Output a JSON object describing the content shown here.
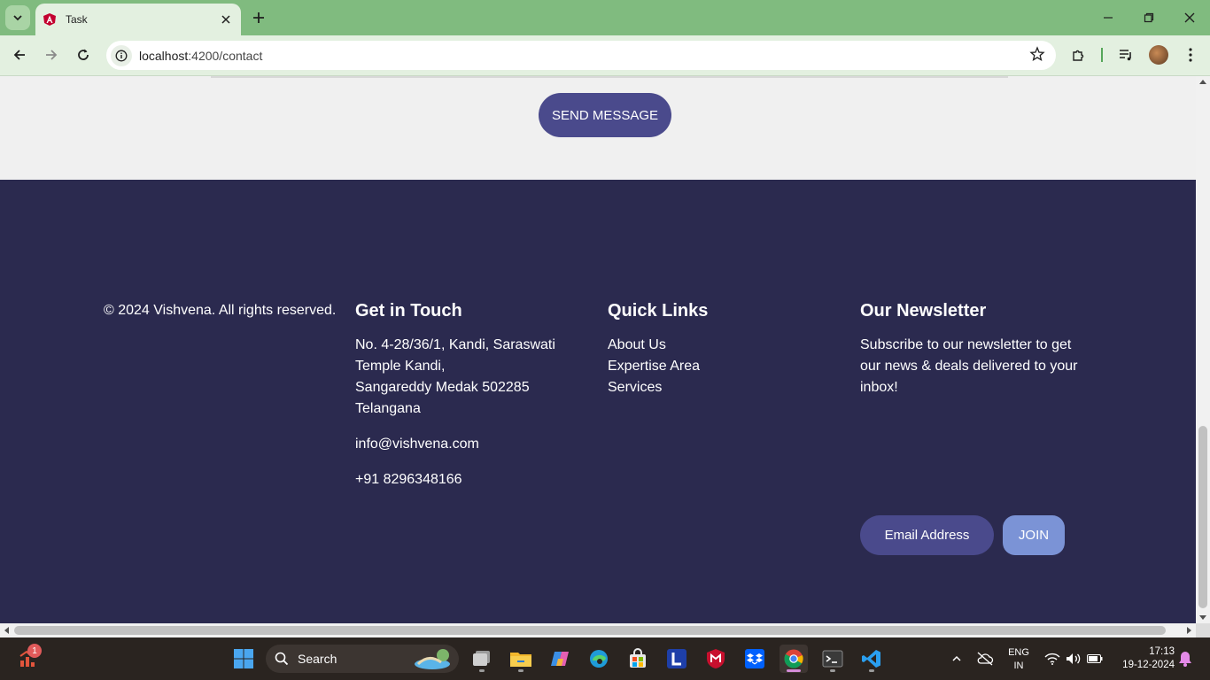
{
  "browser": {
    "tab_title": "Task",
    "url_host": "localhost",
    "url_path": ":4200/contact"
  },
  "page": {
    "send_button_label": "SEND MESSAGE",
    "footer": {
      "copyright": "© 2024 Vishvena. All rights reserved.",
      "contact": {
        "heading": "Get in Touch",
        "address_lines": [
          "No. 4-28/36/1, Kandi, Saraswati",
          "Temple Kandi,",
          "Sangareddy Medak 502285",
          "Telangana"
        ],
        "email": "info@vishvena.com",
        "phone": "+91 8296348166"
      },
      "quick_links": {
        "heading": "Quick Links",
        "items": [
          "About Us",
          "Expertise Area",
          "Services"
        ]
      },
      "newsletter": {
        "heading": "Our Newsletter",
        "description_lines": [
          "Subscribe to our newsletter to get",
          "our news & deals delivered to your",
          "inbox!"
        ],
        "email_placeholder": "Email Address",
        "join_label": "JOIN"
      }
    }
  },
  "taskbar": {
    "notification_count": "1",
    "search_label": "Search",
    "language_top": "ENG",
    "language_bottom": "IN",
    "time": "17:13",
    "date": "19-12-2024"
  },
  "colors": {
    "tabstrip": "#80bb7f",
    "footer_bg": "#2b2a4f",
    "send_button": "#4a4a8c",
    "join_button": "#7b93d6"
  }
}
